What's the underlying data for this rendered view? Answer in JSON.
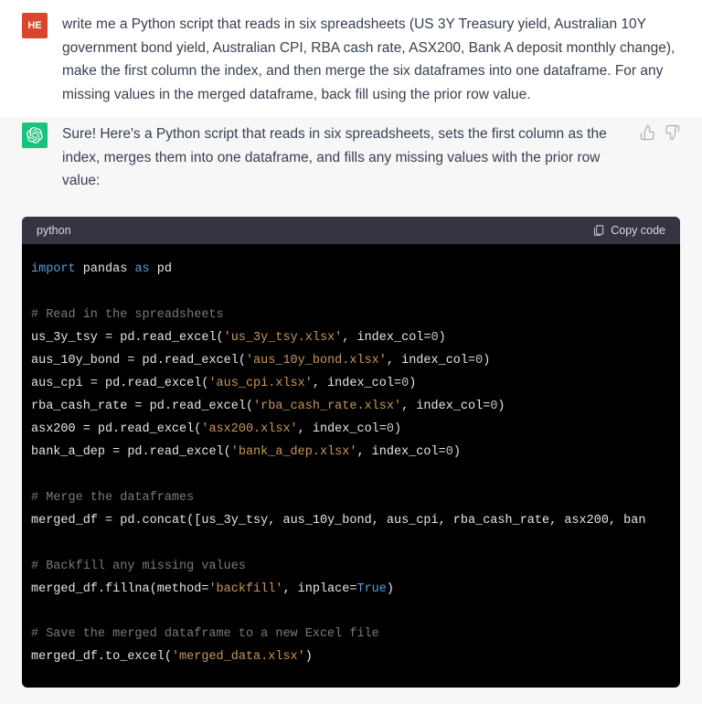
{
  "user": {
    "avatar_label": "HE",
    "message": "write me a Python script that reads in six spreadsheets (US 3Y Treasury yield, Australian 10Y government bond yield, Australian CPI, RBA cash rate, ASX200, Bank A deposit monthly change), make the first column the index, and then merge the six dataframes into one dataframe. For any missing values in the merged dataframe, back fill using the prior row value."
  },
  "assistant": {
    "message": "Sure! Here's a Python script that reads in six spreadsheets, sets the first column as the index, merges them into one dataframe, and fills any missing values with the prior row value:"
  },
  "code": {
    "language_label": "python",
    "copy_label": "Copy code",
    "tokens": {
      "import": "import",
      "pandas": "pandas",
      "as": "as",
      "pd": "pd",
      "cmt_read": "# Read in the spreadsheets",
      "var_us": "us_3y_tsy",
      "eq": " = ",
      "readexcel": "pd.read_excel(",
      "str_us": "'us_3y_tsy.xlsx'",
      "idxcol": ", index_col=",
      "zero": "0",
      "close": ")",
      "var_aus10": "aus_10y_bond",
      "str_aus10": "'aus_10y_bond.xlsx'",
      "var_auscpi": "aus_cpi",
      "str_auscpi": "'aus_cpi.xlsx'",
      "var_rba": "rba_cash_rate",
      "str_rba": "'rba_cash_rate.xlsx'",
      "var_asx": "asx200",
      "str_asx": "'asx200.xlsx'",
      "var_bank": "bank_a_dep",
      "str_bank": "'bank_a_dep.xlsx'",
      "cmt_merge": "# Merge the dataframes",
      "var_merged": "merged_df",
      "concat": "pd.concat([us_3y_tsy, aus_10y_bond, aus_cpi, rba_cash_rate, asx200, ban",
      "cmt_backfill": "# Backfill any missing values",
      "fillna": "merged_df.fillna(method=",
      "str_backfill": "'backfill'",
      "inplace": ", inplace=",
      "true": "True",
      "cmt_save": "# Save the merged dataframe to a new Excel file",
      "toexcel": "merged_df.to_excel(",
      "str_out": "'merged_data.xlsx'"
    }
  },
  "chart_data": null
}
